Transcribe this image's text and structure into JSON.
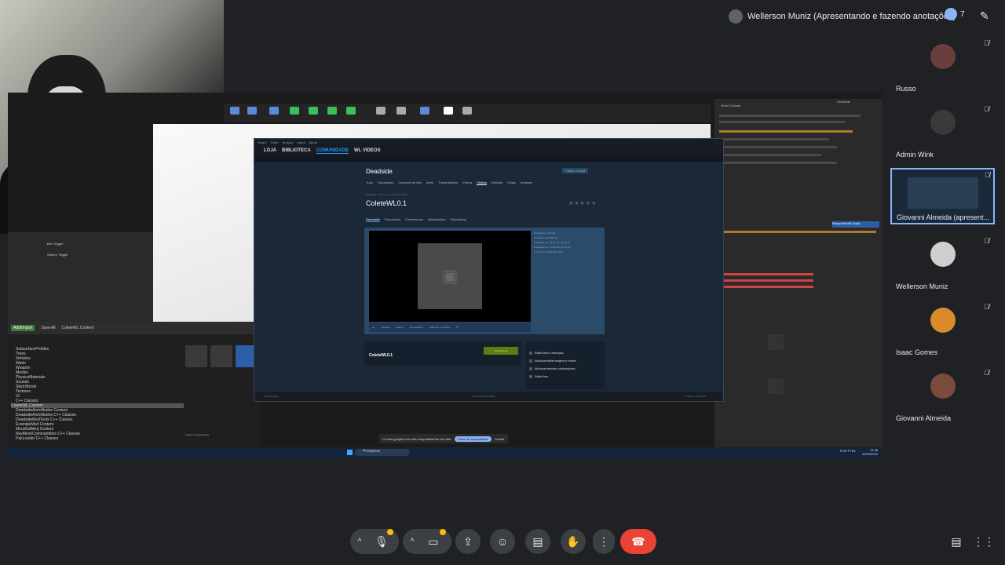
{
  "presenter_bar": {
    "label": "Wellerson Muniz (Apresentando e fazendo anotações)",
    "people_count": "7"
  },
  "participants": [
    {
      "name": "Russo",
      "muted": true,
      "avatar_color": "#6b3e3e"
    },
    {
      "name": "Admin Wink",
      "muted": true,
      "avatar_color": "#3a3a3a"
    },
    {
      "name": "Giovanni Almeida (apresent...",
      "muted": true,
      "avatar_color": "#1b2838"
    },
    {
      "name": "Wellerson Muniz",
      "muted": true,
      "avatar_color": "#cfcfcf"
    },
    {
      "name": "Isaac Gomes",
      "muted": true,
      "avatar_color": "#d98a2b"
    },
    {
      "name": "Giovanni Almeida",
      "muted": true,
      "avatar_color": "#7a4a3a"
    }
  ],
  "shared_screen": {
    "steam": {
      "menubar": [
        "Steam",
        "Exibir",
        "Amigos",
        "Jogos",
        "Ajuda"
      ],
      "nav": [
        "LOJA",
        "BIBLIOTECA",
        "COMUNIDADE",
        "WL VIDEOS"
      ],
      "nav_active": "COMUNIDADE",
      "app_title": "Deadside",
      "app_tabs": [
        "Tudo",
        "Discussões",
        "Capturas de tela",
        "Artes",
        "Transmissões",
        "Vídeos",
        "Oficina",
        "Notícias",
        "Guias",
        "Análises"
      ],
      "app_tab_active": "Oficina",
      "page_button": "Página na loja",
      "breadcrumb": "Deadside > Oficina > Itens de WL Videos",
      "item_title": "ColeteWL0.1",
      "item_tabs": [
        "Descrição",
        "Discussões",
        "Comentários",
        "Atualizações",
        "Estatísticas"
      ],
      "item_tab_active": "Descrição",
      "media_info": [
        "Enviado por: dr-mod",
        "Tamanho: 104,378 KB",
        "Publicado em: 29 de abr. às 13:33",
        "Atualizado em: 29 de abr. às 13:33",
        "1 notas de atualização (ver)"
      ],
      "media_toolbar": [
        "Favoritar",
        "Seguir",
        "Compartilhar",
        "Adicionar à coleção"
      ],
      "subscribe_label": "Inscrever-se",
      "subscribe_name": "ColeteWL0.1",
      "owner_controls": [
        "Editar título e descrição",
        "Adicionar/editar imagens e vídeos",
        "Adicionar/remover colaboradores",
        "Editar tiras"
      ],
      "footer_left": "Adicionar jogo",
      "footer_mid": "Gerenciar downloads",
      "footer_right": "Amigos e conversas"
    },
    "content_browser": {
      "header": [
        "Add/Import",
        "Save All",
        "ColeteWL Content"
      ],
      "tree": [
        "SubsurfaceProfiles",
        "Trees",
        "Vehicles",
        "Water",
        "Weapon",
        "Movies",
        "PhysicsMaterials",
        "Sounds",
        "Sketchbook",
        "Textures",
        "UI",
        "C++ Classes",
        "ColeteWL Content",
        "DeadsideAnimNodes Content",
        "DeadsideAnimNodes C++ Classes",
        "DeadsideModTools C++ Classes",
        "ExampleMod Content",
        "MeuModMrnj Content",
        "NavMeshCommandlets C++ Classes",
        "PakLoader C++ Classes"
      ],
      "status": "3 itens (1 selecionado)"
    },
    "left_panel": [
      "Box Trigger",
      "Sphere Trigger"
    ],
    "share_notice": {
      "text": "O meet.google.com está compartilhando sua tela.",
      "stop_label": "Parar de compartilhar",
      "hide_label": "Ocultar"
    },
    "taskbar": {
      "search_label": "Pesquisar",
      "time": "13:38",
      "date": "29/04/2024",
      "lang": "POR PTB2"
    },
    "outliner": {
      "header": "World Outliner",
      "blueprint_label": "Blueprint/Add Script",
      "title": "Deadside"
    }
  },
  "controls": {
    "colors": {
      "end_call": "#ea4335",
      "bg": "#202124",
      "accent": "#8ab4f8"
    }
  }
}
